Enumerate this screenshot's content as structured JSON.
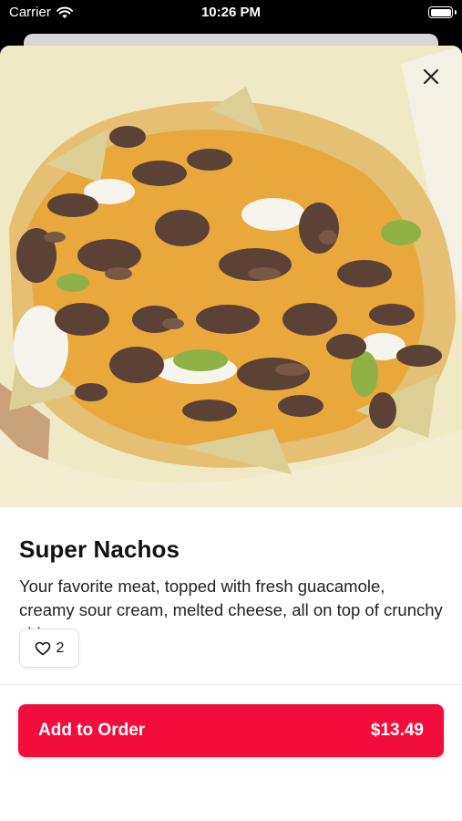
{
  "status_bar": {
    "carrier": "Carrier",
    "time": "10:26 PM",
    "icons": [
      "wifi-icon",
      "battery-icon"
    ]
  },
  "item": {
    "image_icon": "nachos-photo",
    "name": "Super Nachos",
    "description": "Your favorite meat, topped with fresh guacamole, creamy sour cream, melted cheese, all on top of crunchy chips",
    "likes": "2"
  },
  "actions": {
    "close_icon": "close-icon",
    "like_icon": "heart-icon",
    "add_label": "Add to Order",
    "price": "$13.49"
  },
  "colors": {
    "accent": "#f20d3c",
    "background": "#ffffff",
    "status_bar": "#000000"
  }
}
